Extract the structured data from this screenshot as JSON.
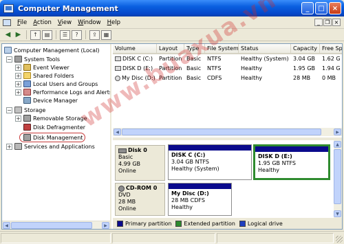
{
  "window": {
    "title": "Computer Management",
    "buttons": {
      "minimize": "_",
      "maximize": "□",
      "close": "×"
    }
  },
  "menu": {
    "items": [
      "File",
      "Action",
      "View",
      "Window",
      "Help"
    ],
    "mdi_buttons": {
      "minimize": "_",
      "restore": "❐",
      "close": "×"
    }
  },
  "toolbar": {
    "back": "◀",
    "forward": "▶",
    "up": "↑",
    "show_tree": "▤",
    "properties": "☰",
    "help": "?",
    "export": "⇪",
    "extra": "▦"
  },
  "tree": {
    "items": [
      {
        "label": "Computer Management (Local)",
        "expander": ""
      },
      {
        "label": "System Tools",
        "expander": "−"
      },
      {
        "label": "Event Viewer",
        "expander": "+"
      },
      {
        "label": "Shared Folders",
        "expander": "+"
      },
      {
        "label": "Local Users and Groups",
        "expander": "+"
      },
      {
        "label": "Performance Logs and Alerts",
        "expander": "+"
      },
      {
        "label": "Device Manager",
        "expander": ""
      },
      {
        "label": "Storage",
        "expander": "−"
      },
      {
        "label": "Removable Storage",
        "expander": "+"
      },
      {
        "label": "Disk Defragmenter",
        "expander": ""
      },
      {
        "label": "Disk Management",
        "expander": ""
      },
      {
        "label": "Services and Applications",
        "expander": "+"
      }
    ]
  },
  "volumes": {
    "columns": [
      "Volume",
      "Layout",
      "Type",
      "File System",
      "Status",
      "Capacity",
      "Free Sp"
    ],
    "rows": [
      [
        "DISK C (C:)",
        "Partition",
        "Basic",
        "NTFS",
        "Healthy (System)",
        "3.04 GB",
        "1.62 G"
      ],
      [
        "DISK D (E:)",
        "Partition",
        "Basic",
        "NTFS",
        "Healthy",
        "1.95 GB",
        "1.94 G"
      ],
      [
        "My Disc (D:)",
        "Partition",
        "Basic",
        "CDFS",
        "Healthy",
        "28 MB",
        "0 MB"
      ]
    ]
  },
  "disks": [
    {
      "name": "Disk 0",
      "type": "Basic",
      "size": "4.99 GB",
      "status": "Online",
      "partitions": [
        {
          "name": "DISK C  (C:)",
          "detail": "3.04 GB NTFS",
          "status": "Healthy (System)"
        },
        {
          "name": "DISK D  (E:)",
          "detail": "1.95 GB NTFS",
          "status": "Healthy"
        }
      ]
    },
    {
      "name": "CD-ROM 0",
      "type": "DVD",
      "size": "28 MB",
      "status": "Online",
      "partitions": [
        {
          "name": "My Disc  (D:)",
          "detail": "28 MB CDFS",
          "status": "Healthy"
        }
      ]
    }
  ],
  "legend": [
    {
      "label": "Primary partition",
      "color": "#0a0a8c"
    },
    {
      "label": "Extended partition",
      "color": "#2e8b2e"
    },
    {
      "label": "Logical drive",
      "color": "#1f3fbf"
    }
  ],
  "watermark": "www.buaxua.vn"
}
